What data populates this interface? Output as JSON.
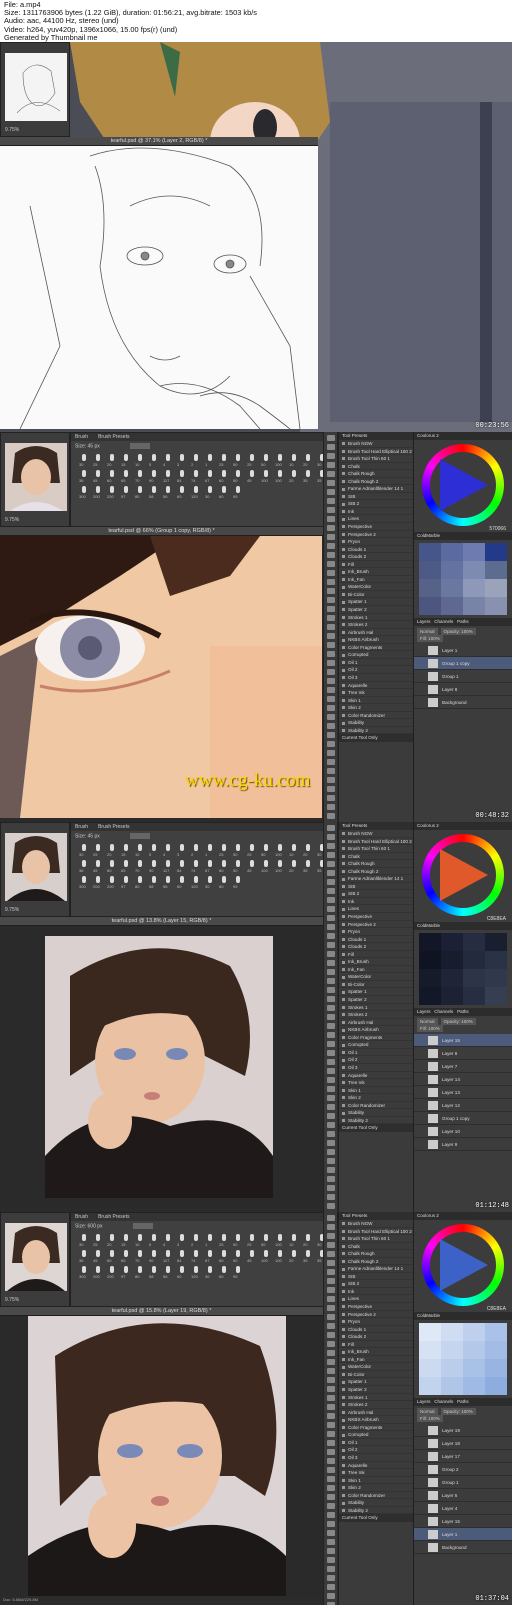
{
  "header": {
    "file": "File: a.mp4",
    "size": "Size: 1311763906 bytes (1.22 GiB), duration: 01:56:21, avg.bitrate: 1503 kb/s",
    "audio": "Audio: aac, 44100 Hz, stereo (und)",
    "video": "Video: h264, yuv420p, 1396x1066, 15.00 fps(r) (und)",
    "generated": "Generated by Thumbnail me"
  },
  "frames": [
    {
      "timestamp": "00:23:56",
      "navigator_pct": "9.75%",
      "doc_title": "tearful.psd @ 37.1% (Layer 2, RGB/8) *"
    },
    {
      "timestamp": "00:48:32",
      "navigator_pct": "9.75%",
      "doc_title": "tearful.psd @ 66% (Group 1 copy, RGB/8) *",
      "brush_tabs": [
        "Brush",
        "Brush Presets"
      ],
      "size_label": "Size:",
      "size_value": "45 px",
      "hex": "570066",
      "watermark": "www.cg-ku.com",
      "layers": [
        "Layer 1",
        "Group 1 copy",
        "Group 1",
        "Layer 8",
        "Background"
      ],
      "selected_layer": 1,
      "layer_tabs": [
        "Layers",
        "Channels",
        "Paths"
      ],
      "blend": "Normal",
      "opacity": "Opacity: 100%",
      "fill": "Fill: 100%"
    },
    {
      "timestamp": "01:12:48",
      "navigator_pct": "9.75%",
      "doc_title": "tearful.psd @ 13.8% (Layer 15, RGB/8) *",
      "brush_tabs": [
        "Brush",
        "Brush Presets"
      ],
      "size_label": "Size:",
      "size_value": "45 px",
      "hex": "C8E8EA",
      "layers": [
        "Layer 15",
        "Layer 6",
        "Layer 7",
        "Layer 14",
        "Layer 13",
        "Layer 12",
        "Group 1 copy",
        "Layer 10",
        "Layer 9"
      ],
      "selected_layer": 0,
      "layer_tabs": [
        "Layers",
        "Channels",
        "Paths"
      ],
      "blend": "Normal",
      "opacity": "Opacity: 100%",
      "fill": "Fill: 100%"
    },
    {
      "timestamp": "01:37:04",
      "navigator_pct": "9.75%",
      "doc_title": "tearful.psd @ 15.8% (Layer 19, RGB/8) *",
      "brush_tabs": [
        "Brush",
        "Brush Presets"
      ],
      "size_label": "Size:",
      "size_value": "600 px",
      "hex": "C8E8EA",
      "layers": [
        "Layer 19",
        "Layer 18",
        "Layer 17",
        "Group 2",
        "Group 1",
        "Layer 5",
        "Layer 4",
        "Layer 15",
        "Layer 1",
        "Background"
      ],
      "selected_layer": 8,
      "layer_tabs": [
        "Layers",
        "Channels",
        "Paths"
      ],
      "blend": "Normal",
      "opacity": "Opacity: 100%",
      "fill": "Fill: 100%",
      "doc_status": "Doc: 5.86M/229.8M"
    }
  ],
  "brush_preset_header": "Tool Presets",
  "brush_presets": [
    "Brush NGW",
    "Brush Tool Hard Elliptical 100 2",
    "Brush Tool Thin 60 1",
    "Chalk",
    "Chalk Rough",
    "Chalk Rough 2",
    "Farme Adrianllblender 14 1",
    "SIB",
    "SIB 2",
    "Ink",
    "Lines",
    "Perspective",
    "Perspective 2",
    "Pryon",
    "Clouds 1",
    "Clouds 2",
    "Fill",
    "Ink_Brush",
    "Ink_Fan",
    "WaterColor",
    "Bi-Color",
    "Spatter 1",
    "Spatter 2",
    "Strokes 1",
    "Strokes 2",
    "Airbrush Hal",
    "NKBS Airbrush",
    "Color Fragments",
    "Corrupted",
    "Oil 1",
    "Oil 2",
    "Oil 3",
    "Aquarelle",
    "Tree Ink",
    "Skin 1",
    "Skin 2",
    "Color Randomizer",
    "Stability",
    "Stability 2"
  ],
  "presets_footer": "Current Tool Only",
  "color_panel_title": "Coolorus 2",
  "swatches_title": "ColdMarble",
  "brush_tip_sizes": [
    "30",
    "25",
    "20",
    "15",
    "10",
    "5",
    "4",
    "3",
    "2",
    "1",
    "25",
    "50",
    "25",
    "50",
    "100",
    "10",
    "20",
    "30",
    "36",
    "45",
    "60",
    "65",
    "70",
    "90",
    "117",
    "84",
    "74",
    "67",
    "60",
    "50",
    "45",
    "100",
    "100",
    "20",
    "35",
    "35",
    "300",
    "200",
    "200",
    "97",
    "80",
    "58",
    "56",
    "60",
    "120",
    "30",
    "60",
    "95"
  ],
  "brand_colors": {
    "ui_dark": "#3c3c3c",
    "selection": "#4d5b7a",
    "watermark": "#ffd700"
  }
}
